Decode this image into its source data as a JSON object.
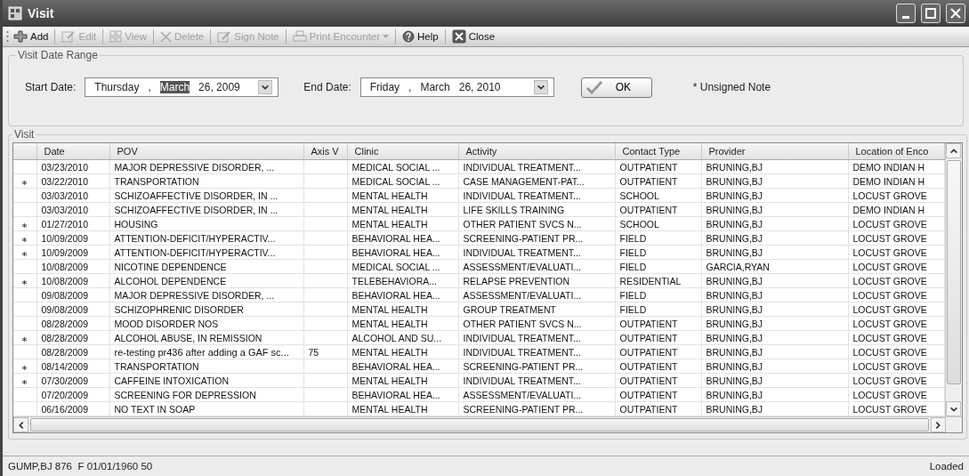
{
  "window": {
    "title": "Visit"
  },
  "toolbar": [
    {
      "kind": "add",
      "label": "Add",
      "disabled": false
    },
    {
      "kind": "edit",
      "label": "Edit",
      "disabled": true
    },
    {
      "kind": "view",
      "label": "View",
      "disabled": true
    },
    {
      "kind": "delete",
      "label": "Delete",
      "disabled": true
    },
    {
      "kind": "sign",
      "label": "Sign Note",
      "disabled": true
    },
    {
      "kind": "print",
      "label": "Print Encounter",
      "disabled": true,
      "dropdown": true
    },
    {
      "kind": "help",
      "label": "Help",
      "disabled": false
    },
    {
      "kind": "close",
      "label": "Close",
      "disabled": false
    }
  ],
  "date_range": {
    "title": "Visit Date Range",
    "start": {
      "label": "Start Date:",
      "segments": [
        {
          "text": "Thursday",
          "selected": false
        },
        {
          "text": ",",
          "selected": false
        },
        {
          "text": "March",
          "selected": true
        },
        {
          "text": "26, 2009",
          "selected": false
        }
      ]
    },
    "end": {
      "label": "End Date:",
      "segments": [
        {
          "text": "Friday",
          "selected": false
        },
        {
          "text": ",",
          "selected": false
        },
        {
          "text": "March",
          "selected": false
        },
        {
          "text": "26, 2010",
          "selected": false
        }
      ]
    },
    "ok_button": "OK",
    "legend": "* Unsigned Note"
  },
  "visits": {
    "title": "Visit",
    "columns": [
      "Date",
      "POV",
      "Axis V",
      "Clinic",
      "Activity",
      "Contact Type",
      "Provider",
      "Location of Enco"
    ],
    "rows": [
      {
        "unsigned": false,
        "cells": [
          "03/23/2010",
          "MAJOR DEPRESSIVE DISORDER, ...",
          "",
          "MEDICAL SOCIAL ...",
          "INDIVIDUAL TREATMENT...",
          "OUTPATIENT",
          "BRUNING,BJ",
          "DEMO INDIAN H"
        ]
      },
      {
        "unsigned": true,
        "cells": [
          "03/22/2010",
          "TRANSPORTATION",
          "",
          "MEDICAL SOCIAL ...",
          "CASE MANAGEMENT-PAT...",
          "OUTPATIENT",
          "BRUNING,BJ",
          "DEMO INDIAN H"
        ]
      },
      {
        "unsigned": false,
        "cells": [
          "03/03/2010",
          "SCHIZOAFFECTIVE DISORDER, IN ...",
          "",
          "MENTAL HEALTH",
          "INDIVIDUAL TREATMENT...",
          "SCHOOL",
          "BRUNING,BJ",
          "LOCUST GROVE"
        ]
      },
      {
        "unsigned": false,
        "cells": [
          "03/03/2010",
          "SCHIZOAFFECTIVE DISORDER, IN ...",
          "",
          "MENTAL HEALTH",
          "LIFE SKILLS TRAINING",
          "OUTPATIENT",
          "BRUNING,BJ",
          "DEMO INDIAN H"
        ]
      },
      {
        "unsigned": true,
        "cells": [
          "01/27/2010",
          "HOUSING",
          "",
          "MENTAL HEALTH",
          "OTHER PATIENT SVCS N...",
          "SCHOOL",
          "BRUNING,BJ",
          "LOCUST GROVE"
        ]
      },
      {
        "unsigned": true,
        "cells": [
          "10/09/2009",
          "ATTENTION-DEFICIT/HYPERACTIV...",
          "",
          "BEHAVIORAL HEA...",
          "SCREENING-PATIENT PR...",
          "FIELD",
          "BRUNING,BJ",
          "LOCUST GROVE"
        ]
      },
      {
        "unsigned": true,
        "cells": [
          "10/09/2009",
          "ATTENTION-DEFICIT/HYPERACTIV...",
          "",
          "BEHAVIORAL HEA...",
          "INDIVIDUAL TREATMENT...",
          "FIELD",
          "BRUNING,BJ",
          "LOCUST GROVE"
        ]
      },
      {
        "unsigned": false,
        "cells": [
          "10/08/2009",
          "NICOTINE DEPENDENCE",
          "",
          "MEDICAL SOCIAL ...",
          "ASSESSMENT/EVALUATI...",
          "FIELD",
          "GARCIA,RYAN",
          "LOCUST GROVE"
        ]
      },
      {
        "unsigned": true,
        "cells": [
          "10/08/2009",
          "ALCOHOL DEPENDENCE",
          "",
          "TELEBEHAVIORA...",
          "RELAPSE PREVENTION",
          "RESIDENTIAL",
          "BRUNING,BJ",
          "LOCUST GROVE"
        ]
      },
      {
        "unsigned": false,
        "cells": [
          "09/08/2009",
          "MAJOR DEPRESSIVE DISORDER, ...",
          "",
          "BEHAVIORAL HEA...",
          "ASSESSMENT/EVALUATI...",
          "FIELD",
          "BRUNING,BJ",
          "LOCUST GROVE"
        ]
      },
      {
        "unsigned": false,
        "cells": [
          "09/08/2009",
          "SCHIZOPHRENIC DISORDER",
          "",
          "MENTAL HEALTH",
          "GROUP TREATMENT",
          "FIELD",
          "BRUNING,BJ",
          "LOCUST GROVE"
        ]
      },
      {
        "unsigned": false,
        "cells": [
          "08/28/2009",
          "MOOD DISORDER NOS",
          "",
          "MENTAL HEALTH",
          "OTHER PATIENT SVCS N...",
          "OUTPATIENT",
          "BRUNING,BJ",
          "LOCUST GROVE"
        ]
      },
      {
        "unsigned": true,
        "cells": [
          "08/28/2009",
          "ALCOHOL ABUSE, IN REMISSION",
          "",
          "ALCOHOL AND SU...",
          "INDIVIDUAL TREATMENT...",
          "OUTPATIENT",
          "BRUNING,BJ",
          "LOCUST GROVE"
        ]
      },
      {
        "unsigned": false,
        "cells": [
          "08/28/2009",
          "re-testing pr436 after adding a GAF sc...",
          "75",
          "MENTAL HEALTH",
          "INDIVIDUAL TREATMENT...",
          "OUTPATIENT",
          "BRUNING,BJ",
          "LOCUST GROVE"
        ]
      },
      {
        "unsigned": true,
        "cells": [
          "08/14/2009",
          "TRANSPORTATION",
          "",
          "BEHAVIORAL HEA...",
          "SCREENING-PATIENT PR...",
          "OUTPATIENT",
          "BRUNING,BJ",
          "LOCUST GROVE"
        ]
      },
      {
        "unsigned": true,
        "cells": [
          "07/30/2009",
          "CAFFEINE INTOXICATION",
          "",
          "MENTAL HEALTH",
          "INDIVIDUAL TREATMENT...",
          "OUTPATIENT",
          "BRUNING,BJ",
          "LOCUST GROVE"
        ]
      },
      {
        "unsigned": false,
        "cells": [
          "07/20/2009",
          "SCREENING FOR DEPRESSION",
          "",
          "BEHAVIORAL HEA...",
          "ASSESSMENT/EVALUATI...",
          "OUTPATIENT",
          "BRUNING,BJ",
          "LOCUST GROVE"
        ]
      },
      {
        "unsigned": false,
        "cells": [
          "06/16/2009",
          "NO TEXT IN SOAP",
          "",
          "MENTAL HEALTH",
          "SCREENING-PATIENT PR...",
          "OUTPATIENT",
          "BRUNING,BJ",
          "LOCUST GROVE"
        ]
      }
    ]
  },
  "status_bar": {
    "patient": "GUMP,BJ 876  F 01/01/1960 50",
    "state": "Loaded"
  }
}
